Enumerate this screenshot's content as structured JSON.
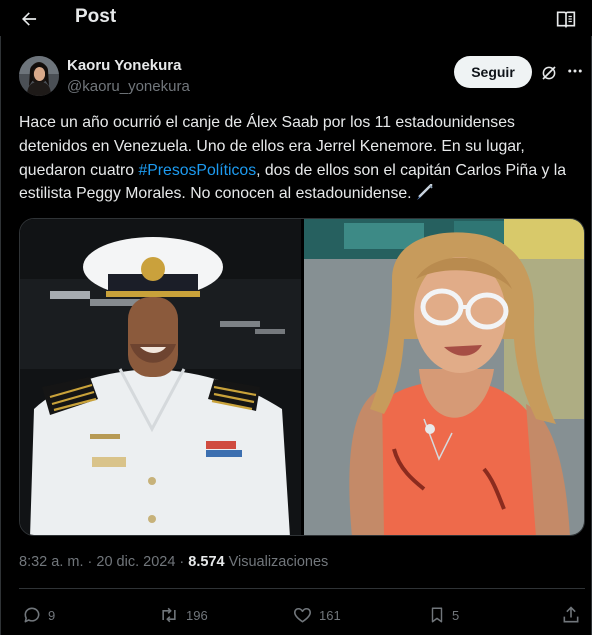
{
  "header": {
    "title": "Post",
    "back_icon": "arrow-left-icon",
    "reader_icon": "reader-mode-icon"
  },
  "author": {
    "display_name": "Kaoru Yonekura",
    "handle": "@kaoru_yonekura",
    "follow_label": "Seguir"
  },
  "tweet": {
    "text_1": "Hace un año ocurrió el canje de Álex Saab por los 11 estadounidenses detenidos en Venezuela. Uno de ellos era Jerrel Kenemore. En su lugar, quedaron cuatro ",
    "hashtag": "#PresosPolíticos",
    "text_2": ", dos de ellos son el capitán Carlos Piña y la estilista Peggy Morales. No conocen al estadounidense.",
    "emoji_icon": "pen-nib-emoji"
  },
  "meta": {
    "time": "8:32 a. m.",
    "separator": " · ",
    "date": "20 dic. 2024",
    "views_count": "8.574",
    "views_label": "Visualizaciones"
  },
  "actions": {
    "replies": "9",
    "reposts": "196",
    "likes": "161",
    "bookmarks": "5"
  },
  "colors": {
    "background": "#000000",
    "text": "#e7e9ea",
    "secondary": "#71767b",
    "accent": "#1d9bf0",
    "border": "#2f3336"
  }
}
